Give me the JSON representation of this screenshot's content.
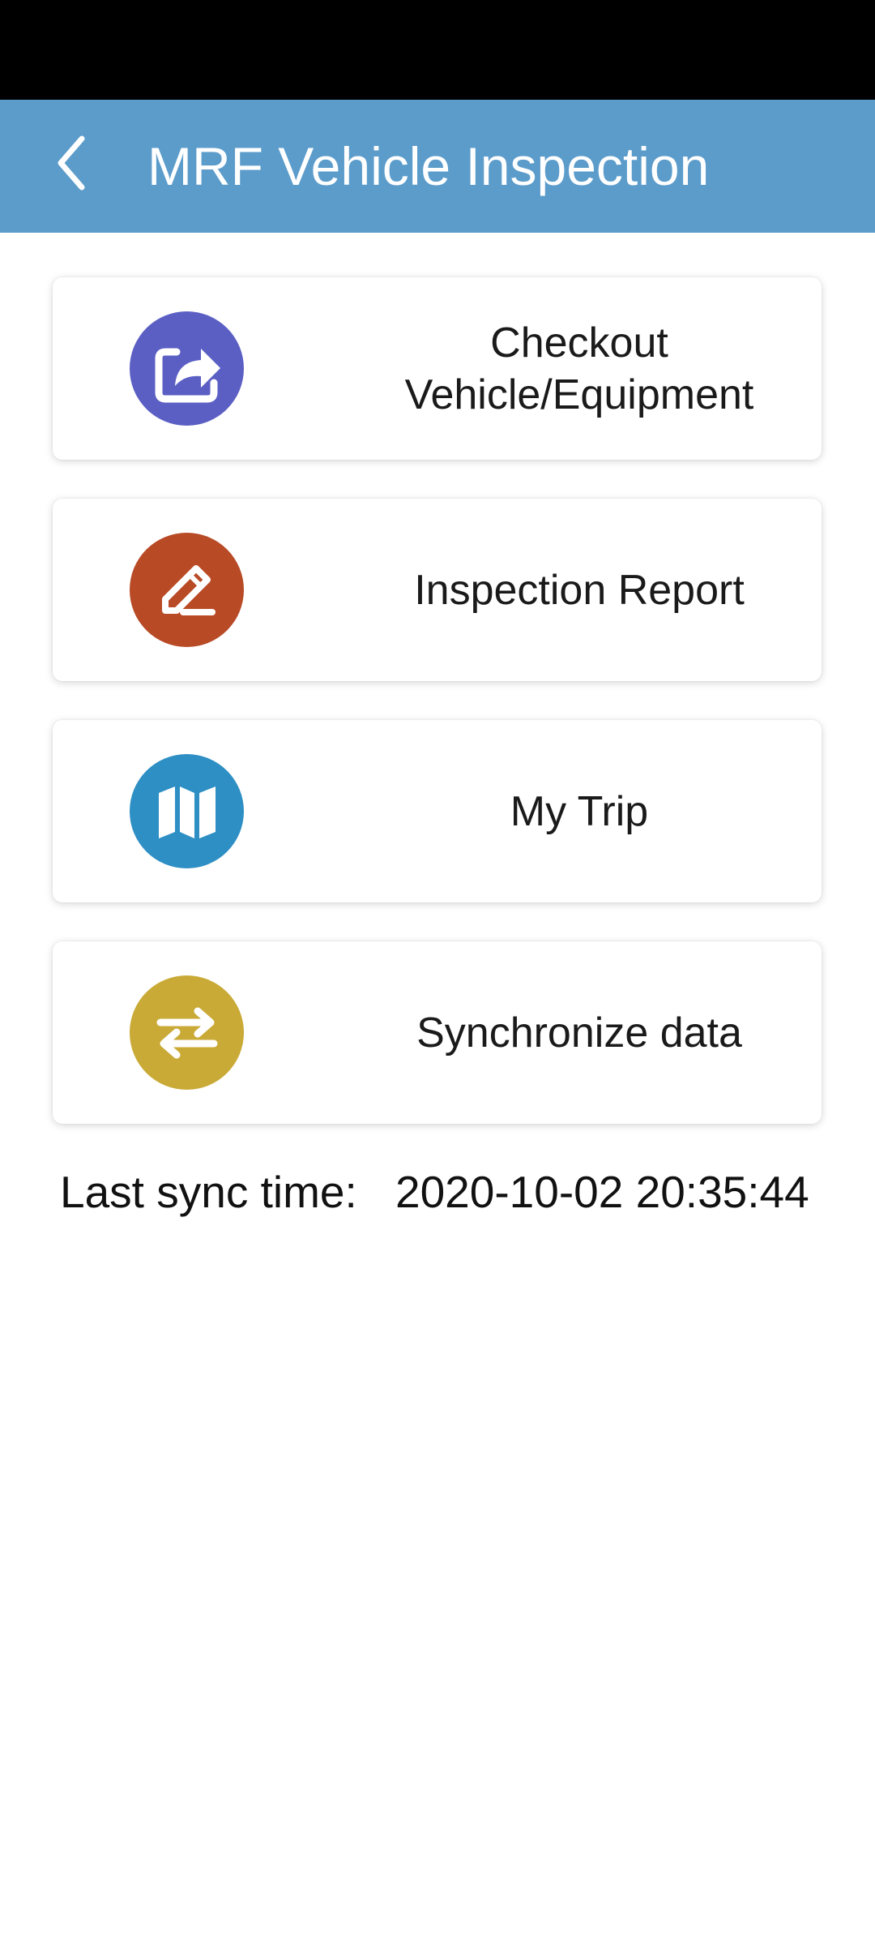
{
  "app_bar": {
    "title": "MRF Vehicle Inspection",
    "background_color": "#5b9ccb",
    "back_icon": "chevron-left-icon"
  },
  "menu": [
    {
      "label": "Checkout\nVehicle/Equipment",
      "icon": "share-box-icon",
      "icon_color": "#5b5fc4"
    },
    {
      "label": "Inspection Report",
      "icon": "pencil-icon",
      "icon_color": "#b84a26"
    },
    {
      "label": "My Trip",
      "icon": "map-icon",
      "icon_color": "#2e8fc4"
    },
    {
      "label": "Synchronize data",
      "icon": "sync-arrows-icon",
      "icon_color": "#c9aa36"
    }
  ],
  "sync": {
    "label": "Last sync time:",
    "value": "2020-10-02 20:35:44"
  }
}
